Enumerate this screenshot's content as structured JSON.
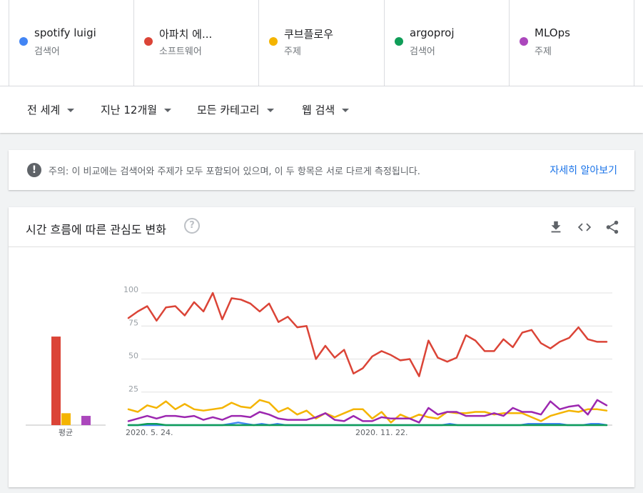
{
  "terms": [
    {
      "name": "spotify luigi",
      "kind": "검색어",
      "color": "#4285f4"
    },
    {
      "name": "아파치 에...",
      "kind": "소프트웨어",
      "color": "#db4437"
    },
    {
      "name": "쿠브플로우",
      "kind": "주제",
      "color": "#f4b400"
    },
    {
      "name": "argoproj",
      "kind": "검색어",
      "color": "#0f9d58"
    },
    {
      "name": "MLOps",
      "kind": "주제",
      "color": "#ab47bc"
    }
  ],
  "filters": {
    "region": "전 세계",
    "period": "지난 12개월",
    "category": "모든 카테고리",
    "search_type": "웹 검색"
  },
  "notice": {
    "prefix": "주의:",
    "message": "이 비교에는 검색어와 주제가 모두 포함되어 있으며, 이 두 항목은 서로 다르게 측정됩니다.",
    "link": "자세히 알아보기"
  },
  "card": {
    "title": "시간 흐름에 따른 관심도 변화",
    "help": "?"
  },
  "chart_data": {
    "type": "line",
    "ylim": [
      0,
      100
    ],
    "yticks": [
      25,
      50,
      75,
      100
    ],
    "xtick_labels": [
      "2020. 5. 24.",
      "2020. 11. 22."
    ],
    "average_label": "평균",
    "averages": [
      {
        "name": "spotify luigi",
        "value": 0,
        "color": "#4285f4"
      },
      {
        "name": "아파치 에...",
        "value": 67,
        "color": "#db4437"
      },
      {
        "name": "쿠브플로우",
        "value": 9,
        "color": "#f4b400"
      },
      {
        "name": "argoproj",
        "value": 0,
        "color": "#0f9d58"
      },
      {
        "name": "MLOps",
        "value": 7,
        "color": "#ab47bc"
      }
    ],
    "series": [
      {
        "name": "spotify luigi",
        "color": "#4285f4",
        "values": [
          0,
          0,
          0,
          0,
          0,
          0,
          0,
          0,
          0,
          0,
          0,
          0,
          0,
          1,
          2,
          1,
          0,
          1,
          0,
          1,
          0,
          0,
          0,
          0,
          0,
          0,
          0,
          0,
          0,
          0,
          0,
          0,
          0,
          0,
          0,
          0,
          0,
          0,
          0,
          0,
          0,
          1,
          0,
          0,
          0,
          0,
          0,
          0,
          0,
          0,
          0,
          1,
          1,
          1,
          1,
          1,
          0,
          0,
          0,
          1,
          1,
          0
        ]
      },
      {
        "name": "아파치 에...",
        "color": "#db4437",
        "values": [
          81,
          86,
          90,
          79,
          89,
          90,
          83,
          93,
          86,
          100,
          80,
          96,
          95,
          92,
          86,
          92,
          78,
          82,
          74,
          75,
          50,
          60,
          51,
          57,
          39,
          43,
          52,
          56,
          53,
          49,
          50,
          37,
          64,
          51,
          48,
          51,
          68,
          64,
          56,
          56,
          65,
          59,
          70,
          72,
          62,
          58,
          63,
          66,
          74,
          65,
          63,
          63
        ]
      },
      {
        "name": "쿠브플로우",
        "color": "#f4b400",
        "values": [
          12,
          10,
          15,
          13,
          18,
          12,
          16,
          12,
          11,
          12,
          13,
          17,
          14,
          13,
          19,
          17,
          10,
          13,
          8,
          11,
          5,
          9,
          6,
          9,
          12,
          12,
          5,
          10,
          2,
          8,
          5,
          8,
          6,
          5,
          10,
          9,
          9,
          10,
          10,
          8,
          9,
          9,
          9,
          6,
          3,
          7,
          9,
          11,
          10,
          12,
          12,
          11
        ]
      },
      {
        "name": "argoproj",
        "color": "#0f9d58",
        "values": [
          0,
          0,
          1,
          1,
          0,
          0,
          0,
          0,
          0,
          0,
          0,
          0,
          0,
          0,
          0,
          0,
          0,
          0,
          0,
          0,
          0,
          0,
          0,
          0,
          0,
          0,
          0,
          0,
          0,
          0,
          0,
          0,
          0,
          0,
          0,
          0,
          0,
          0,
          0,
          0,
          0,
          0,
          0,
          0,
          0,
          0,
          0,
          0,
          0,
          0,
          0,
          0
        ]
      },
      {
        "name": "MLOps",
        "color": "#9c27b0",
        "values": [
          3,
          5,
          7,
          5,
          7,
          7,
          6,
          7,
          4,
          6,
          4,
          7,
          7,
          6,
          10,
          8,
          5,
          4,
          4,
          4,
          6,
          9,
          4,
          3,
          7,
          3,
          3,
          6,
          5,
          5,
          5,
          2,
          13,
          8,
          10,
          10,
          7,
          7,
          7,
          9,
          7,
          13,
          10,
          10,
          8,
          18,
          12,
          14,
          15,
          8,
          19,
          15
        ]
      }
    ]
  }
}
